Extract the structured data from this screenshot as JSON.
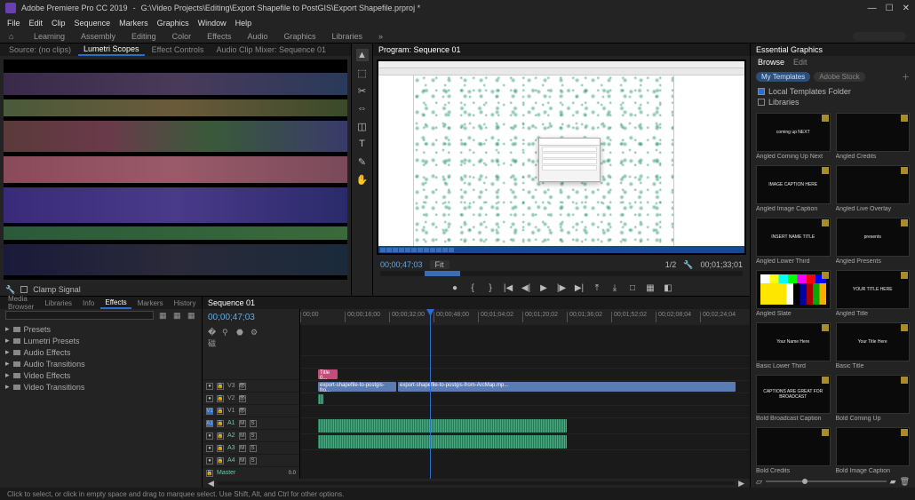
{
  "titlebar": {
    "app": "Adobe Premiere Pro CC 2019",
    "path": "G:\\Video Projects\\Editing\\Export Shapefile to PostGIS\\Export Shapefile.prproj *"
  },
  "menu": [
    "File",
    "Edit",
    "Clip",
    "Sequence",
    "Markers",
    "Graphics",
    "Window",
    "Help"
  ],
  "workspaces": [
    "Learning",
    "Assembly",
    "Editing",
    "Color",
    "Effects",
    "Audio",
    "Graphics",
    "Libraries"
  ],
  "scopes": {
    "tabs": [
      "Source: (no clips)",
      "Lumetri Scopes",
      "Effect Controls",
      "Audio Clip Mixer: Sequence 01"
    ],
    "active": 1,
    "clamp": "Clamp Signal"
  },
  "program": {
    "title": "Program: Sequence 01",
    "tc": "00;00;47;03",
    "fit": "Fit",
    "zoom": "1/2",
    "duration": "00;01;33;01"
  },
  "transport": {
    "marker": "●",
    "in": "{",
    "out": "}",
    "goIn": "|◀",
    "back": "◀◀",
    "step_b": "◀|",
    "play": "▶",
    "step_f": "|▶",
    "fwd": "▶▶",
    "goOut": "▶|",
    "lift": "⤒",
    "extract": "⤓",
    "export": "□",
    "safe": "▦",
    "compare": "◧"
  },
  "project": {
    "tabs": [
      "Media Browser",
      "Libraries",
      "Info",
      "Effects",
      "Markers",
      "History"
    ],
    "active": 3,
    "items": [
      "Presets",
      "Lumetri Presets",
      "Audio Effects",
      "Audio Transitions",
      "Video Effects",
      "Video Transitions"
    ]
  },
  "timeline": {
    "title": "Sequence 01",
    "tc": "00;00;47;03",
    "ruler": [
      "00;00",
      "00;00;16;00",
      "00;00;32;00",
      "00;00;48;00",
      "00;01;04;02",
      "00;01;20;02",
      "00;01;36;02",
      "00;01;52;02",
      "00;02;08;04",
      "00;02;24;04"
    ],
    "tracks": {
      "v3": "V3",
      "v2": "V2",
      "v1": "V1",
      "a1": "A1",
      "a2": "A2",
      "a3": "A3",
      "a4": "A4",
      "master": "Master"
    },
    "clips": {
      "title_v2": "Title 0...",
      "v1": "export-shapefile-to-postgis-fro...",
      "v1b": "export-shapefile-to-postgis-from-ArcMap.mp..."
    }
  },
  "eg": {
    "title": "Essential Graphics",
    "subtabs": [
      "Browse",
      "Edit"
    ],
    "filter": {
      "my": "My Templates",
      "stock": "Adobe Stock"
    },
    "checks": {
      "local": "Local Templates Folder",
      "libs": "Libraries"
    },
    "items": [
      {
        "label": "Angled Coming Up Next",
        "txt": "coming up NEXT"
      },
      {
        "label": "Angled Credits",
        "txt": ""
      },
      {
        "label": "Angled Image Caption",
        "txt": "IMAGE CAPTION HERE"
      },
      {
        "label": "Angled Live Overlay",
        "txt": ""
      },
      {
        "label": "Angled Lower Third",
        "txt": "INSERT NAME TITLE"
      },
      {
        "label": "Angled Presents",
        "txt": "presents"
      },
      {
        "label": "Angled Slate",
        "txt": "",
        "klass": "slate"
      },
      {
        "label": "Angled Title",
        "txt": "YOUR TITLE HERE"
      },
      {
        "label": "Basic Lower Third",
        "txt": "Your Name Here"
      },
      {
        "label": "Basic Title",
        "txt": "Your Title Here"
      },
      {
        "label": "Bold Broadcast Caption",
        "txt": "CAPTIONS ARE GREAT FOR BROADCAST"
      },
      {
        "label": "Bold Coming Up",
        "txt": ""
      },
      {
        "label": "Bold Credits",
        "txt": ""
      },
      {
        "label": "Bold Image Caption",
        "txt": ""
      }
    ]
  },
  "status": "Click to select, or click in empty space and drag to marquee select. Use Shift, Alt, and Ctrl for other options.",
  "tools": [
    "▲",
    "⬚",
    "✂",
    "⇔",
    "◫",
    "T",
    "✎",
    "✋"
  ],
  "icons": {
    "min": "—",
    "max": "☐",
    "close": "✕",
    "home": "⌂",
    "search": "🔍",
    "wrench": "🔧",
    "folder": "▸",
    "chevron": "»"
  }
}
